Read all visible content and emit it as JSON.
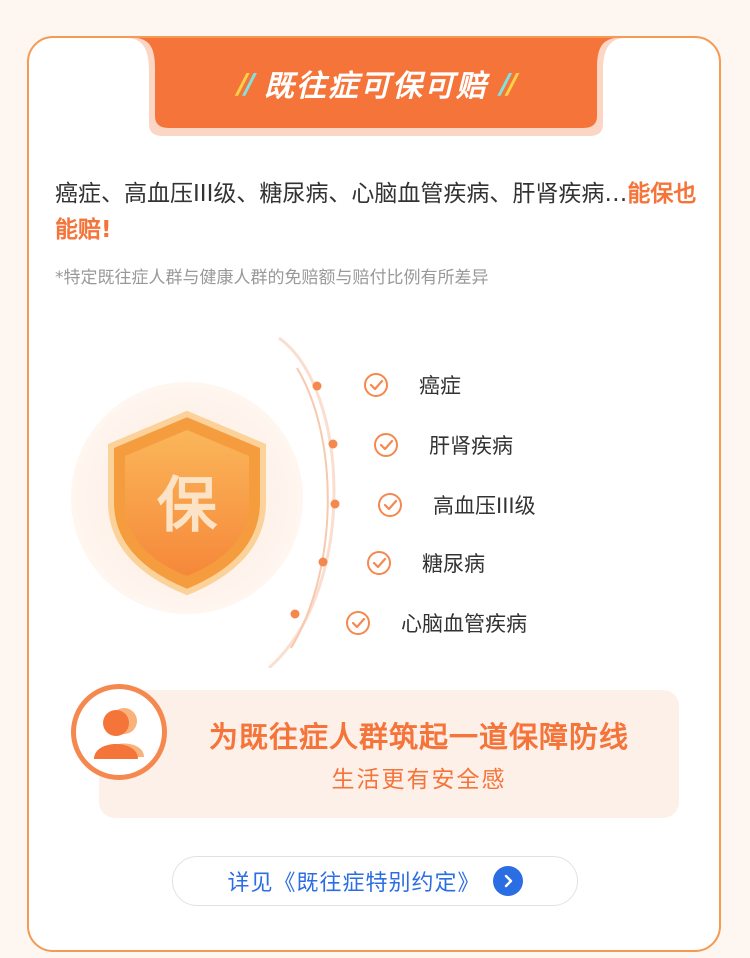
{
  "header": {
    "title": "既往症可保可赔",
    "slash_left": "//",
    "slash_right": "//"
  },
  "intro": {
    "text": "癌症、高血压III级、糖尿病、心脑血管疾病、肝肾疾病…",
    "highlight": "能保也能赔!",
    "note": "*特定既往症人群与健康人群的免赔额与赔付比例有所差异"
  },
  "shield": {
    "char": "保"
  },
  "conditions": [
    {
      "label": "癌症"
    },
    {
      "label": "肝肾疾病"
    },
    {
      "label": "高血压III级"
    },
    {
      "label": "糖尿病"
    },
    {
      "label": "心脑血管疾病"
    }
  ],
  "banner": {
    "title": "为既往症人群筑起一道保障防线",
    "subtitle": "生活更有安全感"
  },
  "link": {
    "label": "详见《既往症特别约定》"
  },
  "colors": {
    "accent": "#f5743a",
    "border": "#f59a52",
    "link": "#2b6de3"
  }
}
